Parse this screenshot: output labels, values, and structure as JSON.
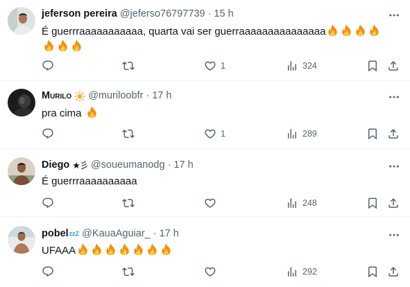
{
  "colors": {
    "accent": "#1d9bf0",
    "muted": "#536471",
    "text": "#0f1419",
    "divider": "#eff3f4"
  },
  "icons": [
    "more-icon",
    "reply-icon",
    "retweet-icon",
    "like-icon",
    "views-icon",
    "bookmark-icon",
    "share-icon",
    "fire-emoji"
  ],
  "tweets": [
    {
      "display_name": "jeferson pereira",
      "handle": "@jeferso76797739",
      "time": "15 h",
      "text": "É guerrraaaaaaaaaaa, quarta vai ser guerraaaaaaaaaaaaaaa",
      "fire_count": 7,
      "likes": "1",
      "views": "324"
    },
    {
      "display_name": "Murilo",
      "handle": "@muriloobfr",
      "time": "17 h",
      "text": "pra cima",
      "fire_count": 1,
      "likes": "1",
      "views": "289"
    },
    {
      "display_name": "Diego",
      "name_suffix": "★彡",
      "handle": "@soueumanodg",
      "time": "17 h",
      "text": "É guerrraaaaaaaaaa",
      "fire_count": 0,
      "likes": "",
      "views": "248"
    },
    {
      "display_name": "pobel",
      "name_suffix": "zzZ",
      "handle": "@KauaAguiar_",
      "time": "17 h",
      "text": "UFAAA",
      "fire_count": 7,
      "likes": "",
      "views": "292"
    }
  ]
}
